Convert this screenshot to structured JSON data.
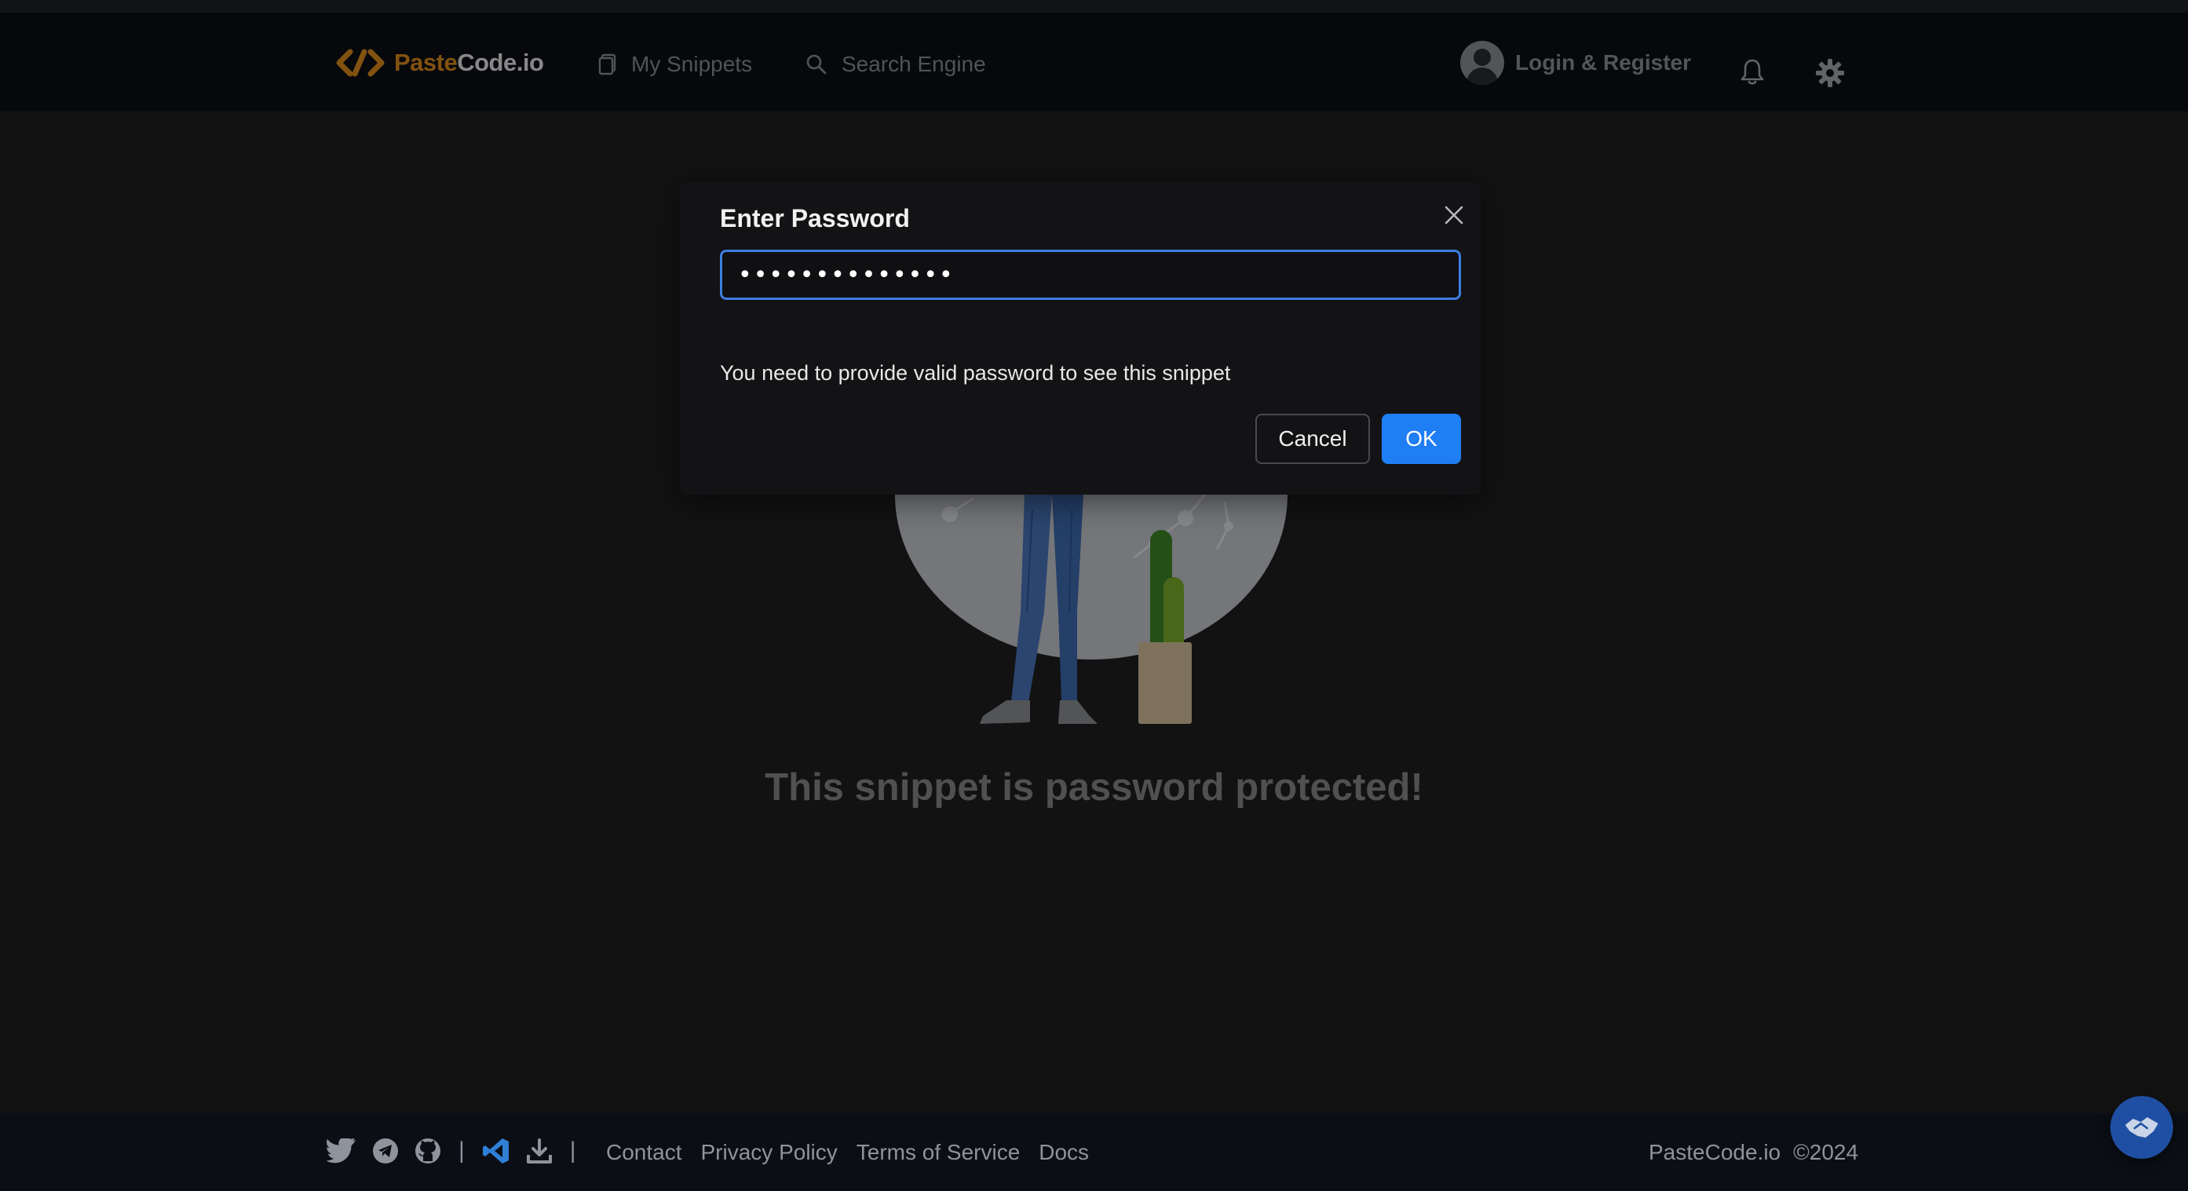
{
  "brand": {
    "name_part1": "Paste",
    "name_part2": "Code.io",
    "accent_color": "#e08e1d"
  },
  "nav": {
    "snippets_label": "My Snippets",
    "snippets_icon": "clipboard-icon",
    "search_label": "Search Engine",
    "search_icon": "search-icon",
    "login_label": "Login & Register",
    "bell_icon": "bell-icon",
    "settings_icon": "gear-icon"
  },
  "page": {
    "protected_title": "This snippet is password protected!"
  },
  "modal": {
    "title": "Enter Password",
    "password_value": "••••••••••••••",
    "message": "You need to provide valid password to see this snippet",
    "cancel_label": "Cancel",
    "ok_label": "OK",
    "ok_color": "#1f7ef3"
  },
  "footer": {
    "icons": [
      "twitter-icon",
      "telegram-icon",
      "github-icon",
      "vscode-icon",
      "download-icon"
    ],
    "separator": "|",
    "links": [
      "Contact",
      "Privacy Policy",
      "Terms of Service",
      "Docs"
    ],
    "copyright_name": "PasteCode.io",
    "copyright_year": "©2024"
  }
}
